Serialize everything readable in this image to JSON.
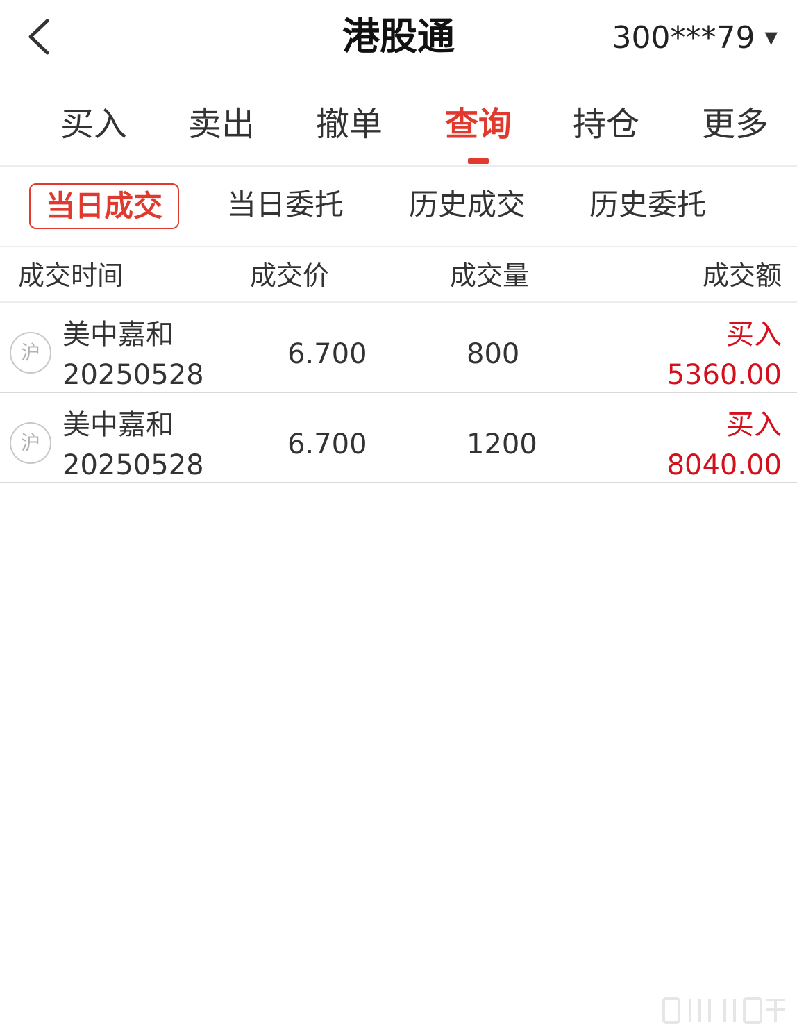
{
  "header": {
    "title": "港股通",
    "account": "300***79",
    "back_icon": "chevron-left-icon",
    "caret_icon": "caret-down-icon",
    "caret_glyph": "▼"
  },
  "main_tabs": [
    {
      "label": "买入",
      "active": false
    },
    {
      "label": "卖出",
      "active": false
    },
    {
      "label": "撤单",
      "active": false
    },
    {
      "label": "查询",
      "active": true
    },
    {
      "label": "持仓",
      "active": false
    },
    {
      "label": "更多",
      "active": false
    }
  ],
  "sub_tabs": [
    {
      "label": "当日成交",
      "active": true
    },
    {
      "label": "当日委托",
      "active": false
    },
    {
      "label": "历史成交",
      "active": false
    },
    {
      "label": "历史委托",
      "active": false
    }
  ],
  "columns": [
    "成交时间",
    "成交价",
    "成交量",
    "成交额"
  ],
  "trades": [
    {
      "market": "沪",
      "name": "美中嘉和",
      "date": "20250528",
      "price": "6.700",
      "qty": "800",
      "side": "买入",
      "amount": "5360.00"
    },
    {
      "market": "沪",
      "name": "美中嘉和",
      "date": "20250528",
      "price": "6.700",
      "qty": "1200",
      "side": "买入",
      "amount": "8040.00"
    }
  ],
  "colors": {
    "accent": "#e03a2f",
    "buy": "#d4101c",
    "text": "#333333",
    "divider": "#ececec"
  }
}
